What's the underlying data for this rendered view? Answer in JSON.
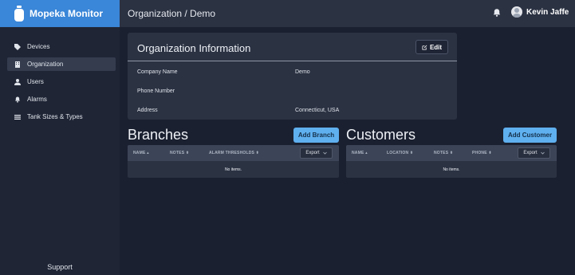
{
  "app": {
    "brand": "Mopeka Monitor",
    "breadcrumb": "Organization / Demo",
    "user_name": "Kevin Jaffe",
    "accent_color": "#3a86d8"
  },
  "sidebar": {
    "items": [
      {
        "label": "Devices",
        "icon": "tag-icon"
      },
      {
        "label": "Organization",
        "icon": "building-icon",
        "active": true
      },
      {
        "label": "Users",
        "icon": "user-icon"
      },
      {
        "label": "Alarms",
        "icon": "bell-icon"
      },
      {
        "label": "Tank Sizes & Types",
        "icon": "list-icon"
      }
    ],
    "support_label": "Support"
  },
  "organization": {
    "title": "Organization Information",
    "edit_label": "Edit",
    "fields": [
      {
        "label": "Company Name",
        "value": "Demo"
      },
      {
        "label": "Phone Number",
        "value": ""
      },
      {
        "label": "Address",
        "value": "Connecticut, USA"
      }
    ]
  },
  "branches": {
    "title": "Branches",
    "add_label": "Add Branch",
    "columns": [
      "NAME ▴",
      "NOTES ⬍",
      "ALARM THRESHOLDS ⬍"
    ],
    "export_label": "Export",
    "empty_text": "No items."
  },
  "customers": {
    "title": "Customers",
    "add_label": "Add Customer",
    "columns": [
      "NAME ▴",
      "LOCATION ⬍",
      "NOTES ⬍",
      "PHONE ⬍"
    ],
    "export_label": "Export",
    "empty_text": "No items."
  }
}
